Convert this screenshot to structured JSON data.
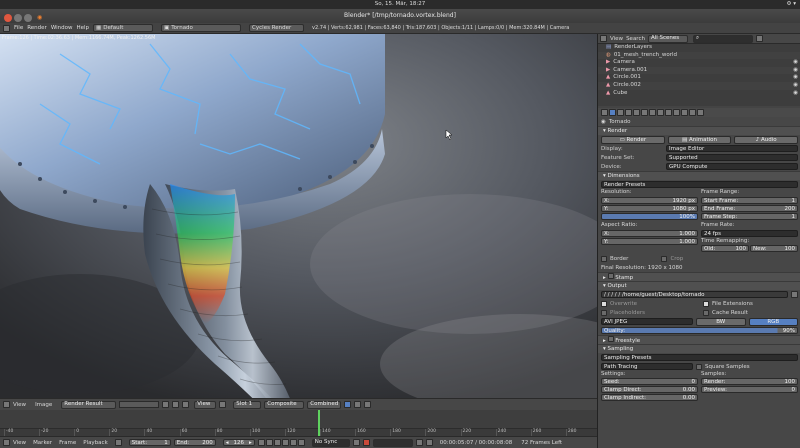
{
  "system": {
    "datetime": "So, 15. Mär, 18:27"
  },
  "window": {
    "title": "Blender* [/tmp/tornado.vortex.blend]",
    "logo": "blender"
  },
  "menubar": {
    "items": [
      "File",
      "Render",
      "Window",
      "Help"
    ],
    "layout": "Default",
    "scene": "Tornado",
    "engine": "Cycles Render",
    "stats": "v2.74 | Verts:62,981 | Faces:63,840 | Tris:187,603 | Objects:1/11 | Lamps:0/0 | Mem:320.84M | Camera"
  },
  "viewport": {
    "info": "Frame:126 | Time:02:36.63 | Mem:1166.74M, Peak:1262.56M",
    "header": {
      "view": "View",
      "image": "Image",
      "render_result": "Render Result",
      "view2": "View",
      "slot": "Slot 1",
      "composite": "Composite",
      "combined": "Combined"
    }
  },
  "outliner": {
    "view": "View",
    "search": "Search",
    "scope": "All Scenes",
    "rows": [
      "RenderLayers",
      "01_mesh_trench_world",
      "Camera",
      "Camera.001",
      "Circle.001",
      "Circle.002",
      "Cube"
    ]
  },
  "properties": {
    "scene_name": "Tornado",
    "render_section": "Render",
    "render_btn": "Render",
    "animation_btn": "Animation",
    "audio_btn": "Audio",
    "display_label": "Display:",
    "display_value": "Image Editor",
    "featureset_label": "Feature Set:",
    "featureset_value": "Supported",
    "device_label": "Device:",
    "device_value": "GPU Compute",
    "dimensions_section": "Dimensions",
    "render_presets": "Render Presets",
    "resolution_label": "Resolution:",
    "res_x_label": "X:",
    "res_x": "1920 px",
    "res_y_label": "Y:",
    "res_y": "1080 px",
    "res_pct": "100%",
    "frame_range_label": "Frame Range:",
    "start_label": "Start Frame:",
    "start": "1",
    "end_label": "End Frame:",
    "end": "200",
    "step_label": "Frame Step:",
    "step": "1",
    "aspect_label": "Aspect Ratio:",
    "asp_x_label": "X:",
    "asp_x": "1.000",
    "asp_y_label": "Y:",
    "asp_y": "1.000",
    "frame_rate_label": "Frame Rate:",
    "frame_rate": "24 fps",
    "time_remap_label": "Time Remapping:",
    "old_label": "Old:",
    "old": "100",
    "new_label": "New:",
    "new": "100",
    "border_label": "Border",
    "crop_label": "Crop",
    "final_res": "Final Resolution: 1920 x 1080",
    "stamp_section": "Stamp",
    "output_section": "Output",
    "output_path": "/ / / / / /home/guest/Desktop/tornado",
    "overwrite_label": "Overwrite",
    "file_ext_label": "File Extensions",
    "placeholders_label": "Placeholders",
    "cache_label": "Cache Result",
    "format": "AVI JPEG",
    "bw_label": "BW",
    "rgb_label": "RGB",
    "quality_label": "Quality:",
    "quality": "90%",
    "freestyle_section": "Freestyle",
    "sampling_section": "Sampling",
    "sampling_presets": "Sampling Presets",
    "path_tracing": "Path Tracing",
    "square_samples": "Square Samples",
    "settings_label": "Settings:",
    "samples_label": "Samples:",
    "seed_label": "Seed:",
    "seed": "0",
    "clamp_direct_label": "Clamp Direct:",
    "clamp_direct": "0.00",
    "clamp_indirect_label": "Clamp Indirect:",
    "clamp_indirect": "0.00",
    "render_samples_label": "Render:",
    "render_samples": "100",
    "preview_samples_label": "Preview:",
    "preview_samples": "0"
  },
  "timeline": {
    "menu": [
      "View",
      "Marker",
      "Frame",
      "Playback"
    ],
    "start_label": "Start:",
    "start": "1",
    "end_label": "End:",
    "end": "200",
    "current": "126",
    "sync": "No Sync",
    "timecode": "00:00:05:07 / 00:00:08:08",
    "frames_left": "72 Frames Left",
    "ticks": [
      "-40",
      "-20",
      "0",
      "20",
      "40",
      "60",
      "80",
      "100",
      "120",
      "140",
      "160",
      "180",
      "200",
      "220",
      "240",
      "260",
      "280"
    ]
  }
}
